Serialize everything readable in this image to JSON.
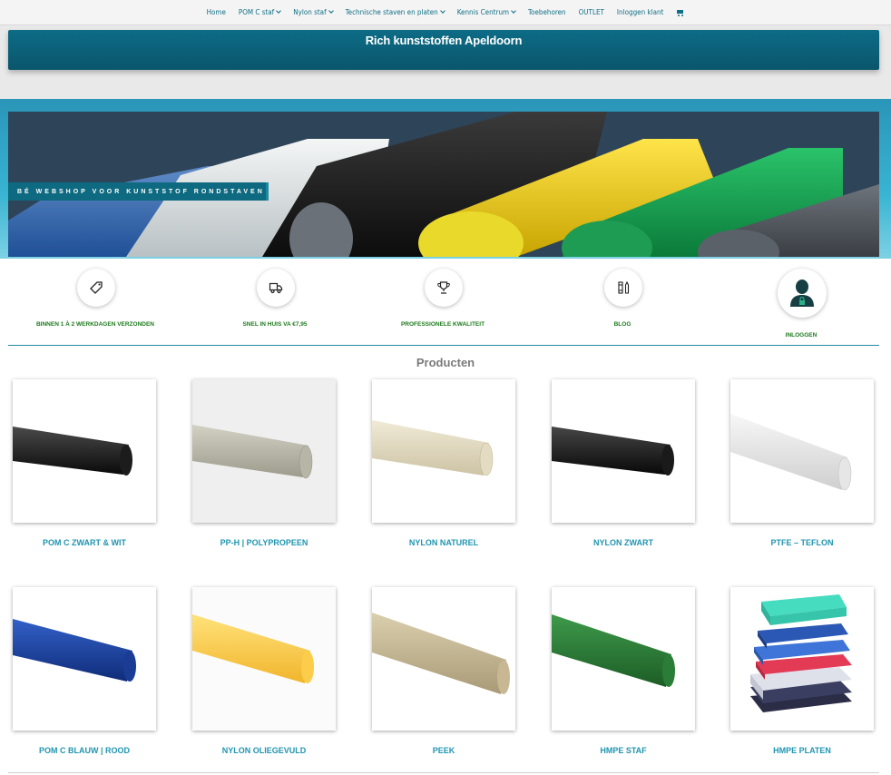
{
  "nav": {
    "items": [
      {
        "label": "Home",
        "has_dropdown": false
      },
      {
        "label": "POM C staf",
        "has_dropdown": true
      },
      {
        "label": "Nylon staf",
        "has_dropdown": true
      },
      {
        "label": "Technische staven en platen",
        "has_dropdown": true
      },
      {
        "label": "Kennis Centrum",
        "has_dropdown": true
      },
      {
        "label": "Toebehoren",
        "has_dropdown": false
      },
      {
        "label": "OUTLET",
        "has_dropdown": false
      },
      {
        "label": "Inloggen klant",
        "has_dropdown": false
      }
    ],
    "cart_icon": "shopping-cart-icon"
  },
  "header": {
    "title": "Rich kunststoffen Apeldoorn"
  },
  "hero": {
    "caption": "BÉ WEBSHOP VOOR KUNSTSTOF RONDSTAVEN"
  },
  "features": [
    {
      "label": "BINNEN 1 À 2 WERKDAGEN VERZONDEN",
      "icon": "tag-icon"
    },
    {
      "label": "SNEL IN HUIS VA €7,95",
      "icon": "truck-icon"
    },
    {
      "label": "PROFESSIONELE KWALITEIT",
      "icon": "trophy-icon"
    },
    {
      "label": "BLOG",
      "icon": "blog-icon"
    },
    {
      "label": "INLOGGEN",
      "icon": "user-lock-icon"
    }
  ],
  "products_title": "Producten",
  "products": [
    {
      "name": "POM C ZWART & WIT",
      "color": "#151515"
    },
    {
      "name": "PP-H | POLYPROPEEN",
      "color": "#b7b6a6"
    },
    {
      "name": "NYLON NATUREL",
      "color": "#e4dcc2"
    },
    {
      "name": "NYLON ZWART",
      "color": "#161616"
    },
    {
      "name": "PTFE – TEFLON",
      "color": "#ececec"
    },
    {
      "name": "POM C BLAUW | ROOD",
      "color": "#173a9a"
    },
    {
      "name": "NYLON OLIEGEVULD",
      "color": "#fcd153"
    },
    {
      "name": "PEEK",
      "color": "#c7b893"
    },
    {
      "name": "HMPE STAF",
      "color": "#2a7d36"
    },
    {
      "name": "HMPE PLATEN",
      "color": "#2f6fd0"
    }
  ],
  "colors": {
    "accent": "#0d6c86",
    "feature_text": "#1d7a1d",
    "product_text": "#1f95b0"
  }
}
